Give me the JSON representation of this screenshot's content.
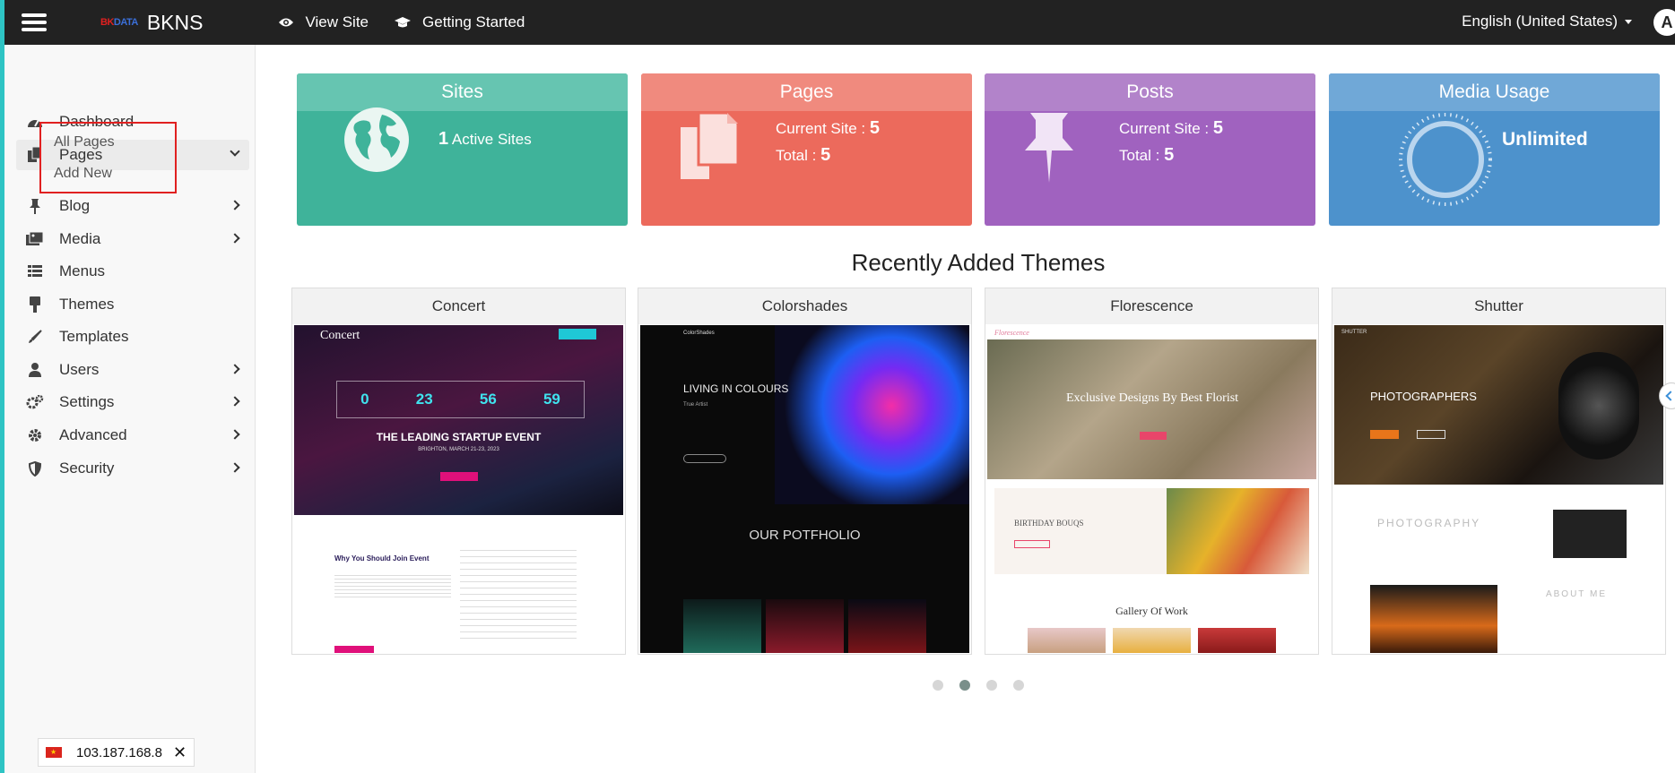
{
  "header": {
    "brand_logo_bk": "BK",
    "brand_logo_data": "DATA",
    "brand_name": "BKNS",
    "nav": [
      {
        "label": "View Site",
        "icon": "eye-icon"
      },
      {
        "label": "Getting Started",
        "icon": "graduation-cap-icon"
      }
    ],
    "language": "English (United States)",
    "avatar_letter": "A"
  },
  "sidebar": {
    "items": [
      {
        "label": "Dashboard",
        "icon": "tachometer-icon"
      },
      {
        "label": "Pages",
        "icon": "copy-icon",
        "expanded": true
      },
      {
        "label": "Blog",
        "icon": "thumbtack-icon"
      },
      {
        "label": "Media",
        "icon": "photo-icon"
      },
      {
        "label": "Menus",
        "icon": "list-icon"
      },
      {
        "label": "Themes",
        "icon": "brush-icon"
      },
      {
        "label": "Templates",
        "icon": "paintbrush-icon"
      },
      {
        "label": "Users",
        "icon": "user-icon"
      },
      {
        "label": "Settings",
        "icon": "gears-icon"
      },
      {
        "label": "Advanced",
        "icon": "gear-icon"
      },
      {
        "label": "Security",
        "icon": "shield-icon"
      }
    ],
    "pages_submenu": [
      "All Pages",
      "Add New"
    ]
  },
  "stats": {
    "sites": {
      "title": "Sites",
      "count": "1",
      "label": "Active Sites"
    },
    "pages": {
      "title": "Pages",
      "current_label": "Current Site :",
      "current_value": "5",
      "total_label": "Total :",
      "total_value": "5"
    },
    "posts": {
      "title": "Posts",
      "current_label": "Current Site :",
      "current_value": "5",
      "total_label": "Total :",
      "total_value": "5"
    },
    "media": {
      "title": "Media Usage",
      "value": "Unlimited"
    }
  },
  "themes": {
    "title": "Recently Added Themes",
    "items": [
      {
        "name": "Concert",
        "heading": "THE LEADING STARTUP EVENT",
        "sub": "BRIGHTON, MARCH 21-23, 2023",
        "counters": [
          "0",
          "23",
          "56",
          "59"
        ],
        "section": "Why You Should Join Event",
        "logo": "Concert"
      },
      {
        "name": "Colorshades",
        "heading": "LIVING IN COLOURS",
        "sub": "True Artist",
        "section": "OUR POTFHOLIO",
        "logo": "ColorShades"
      },
      {
        "name": "Florescence",
        "heading": "Exclusive Designs By Best Florist",
        "section": "BIRTHDAY BOUQS",
        "gallery": "Gallery Of Work",
        "logo": "Florescence"
      },
      {
        "name": "Shutter",
        "heading": "PHOTOGRAPHERS",
        "section": "PHOTOGRAPHY",
        "about": "ABOUT ME",
        "logo": "SHUTTER"
      }
    ],
    "pagination": {
      "count": 4,
      "active": 2
    }
  },
  "ip_widget": {
    "address": "103.187.168.8",
    "flag": "vietnam-flag-icon"
  }
}
